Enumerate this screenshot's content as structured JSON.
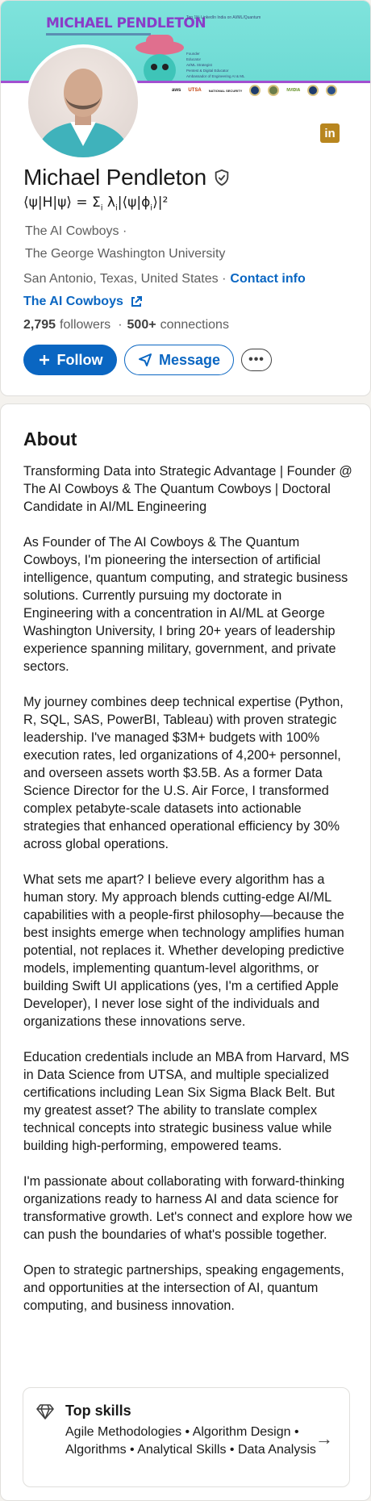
{
  "banner": {
    "title": "MICHAEL PENDLETON",
    "tagline": "Top 1% LinkedIn India on AI/ML/Quantum",
    "list": [
      "Founder",
      "Educator",
      "AI/ML Strategist",
      "Pentest & Digital Educator",
      "Ambassador of Engineering AI & ML"
    ],
    "logos": [
      "aws",
      "UTSA",
      "NATIONAL SECURITY",
      "",
      "",
      "NVIDIA",
      "",
      ""
    ]
  },
  "profile": {
    "name": "Michael Pendleton",
    "headline_prefix": "⟨ψ|H|ψ⟩ = Σ",
    "headline_sub1": "i",
    "headline_mid": " λ",
    "headline_sub2": "i",
    "headline_mid2": "|⟨ψ|ϕ",
    "headline_sub3": "i",
    "headline_suffix": "⟩|²",
    "company": "The AI Cowboys ·",
    "school": "The George Washington University",
    "location": "San Antonio, Texas, United States ·",
    "contact_label": "Contact info",
    "website": "The AI Cowboys",
    "followers_count": "2,795",
    "followers_label": "followers",
    "connections_count": "500+",
    "connections_label": "connections",
    "follow_label": "Follow",
    "message_label": "Message",
    "more_label": "•••"
  },
  "about": {
    "title": "About",
    "paragraphs": [
      "Transforming Data into Strategic Advantage | Founder @ The AI Cowboys & The Quantum Cowboys | Doctoral Candidate in AI/ML Engineering",
      "As Founder of The AI Cowboys & The Quantum Cowboys, I'm pioneering the intersection of artificial intelligence, quantum computing, and strategic business solutions. Currently pursuing my doctorate in Engineering with a concentration in AI/ML at George Washington University, I bring 20+ years of leadership experience spanning military, government, and private sectors.",
      "My journey combines deep technical expertise (Python, R, SQL, SAS, PowerBI, Tableau) with proven strategic leadership. I've managed $3M+ budgets with 100% execution rates, led organizations of 4,200+ personnel, and overseen assets worth $3.5B. As a former Data Science Director for the U.S. Air Force, I transformed complex petabyte-scale datasets into actionable strategies that enhanced operational efficiency by 30% across global operations.",
      "What sets me apart? I believe every algorithm has a human story. My approach blends cutting-edge AI/ML capabilities with a people-first philosophy—because the best insights emerge when technology amplifies human potential, not replaces it. Whether developing predictive models, implementing quantum-level algorithms, or building Swift UI applications (yes, I'm a certified Apple Developer), I never lose sight of the individuals and organizations these innovations serve.",
      "Education credentials include an MBA from Harvard, MS in Data Science from UTSA, and multiple specialized certifications including Lean Six Sigma Black Belt. But my greatest asset? The ability to translate complex technical concepts into strategic business value while building high-performing, empowered teams.",
      "I'm passionate about collaborating with forward-thinking organizations ready to harness AI and data science for transformative growth. Let's connect and explore how we can push the boundaries of what's possible together.",
      "Open to strategic partnerships, speaking engagements, and opportunities at the intersection of AI, quantum computing, and business innovation."
    ],
    "top_skills_title": "Top skills",
    "top_skills_list": "Agile Methodologies • Algorithm Design • Algorithms • Analytical Skills • Data Analysis"
  },
  "icons": {
    "verified": "verified-shield-icon",
    "external": "external-link-icon",
    "plus": "plus-icon",
    "send": "send-icon",
    "diamond": "diamond-icon",
    "arrow": "arrow-right-icon",
    "linkedin": "linkedin-icon"
  },
  "colors": {
    "accent": "#0a66c2",
    "banner": "#69d8d2",
    "banner_title": "#8a3cc8",
    "linkedin_badge": "#b8861f"
  }
}
